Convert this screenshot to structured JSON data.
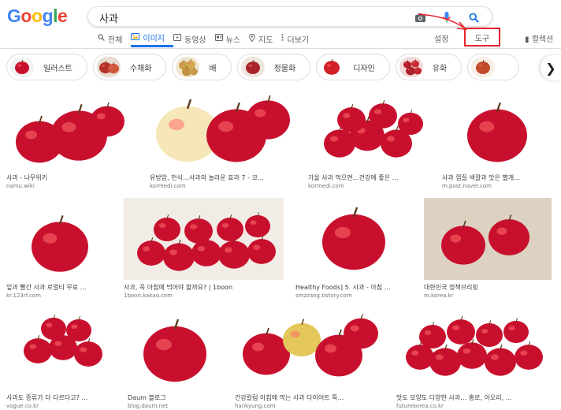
{
  "logo": {
    "letters": [
      "G",
      "o",
      "o",
      "g",
      "l",
      "e"
    ],
    "colors": [
      "#4285f4",
      "#ea4335",
      "#fbbc05",
      "#4285f4",
      "#34a853",
      "#ea4335"
    ]
  },
  "search": {
    "query": "사과"
  },
  "tabs": [
    {
      "label": "전체",
      "icon": "search-icon"
    },
    {
      "label": "이미지",
      "icon": "image-icon",
      "active": true
    },
    {
      "label": "동영상",
      "icon": "video-icon"
    },
    {
      "label": "뉴스",
      "icon": "news-icon"
    },
    {
      "label": "지도",
      "icon": "map-pin-icon"
    },
    {
      "label": "더보기",
      "icon": "more-icon"
    }
  ],
  "toolbar": {
    "settings": "설정",
    "tools": "도구",
    "collections": "컬렉션"
  },
  "chips": [
    {
      "label": "일러스트",
      "thumb": "apple-icon"
    },
    {
      "label": "수채화",
      "thumb": "apple-icon"
    },
    {
      "label": "배",
      "thumb": "pear-icon"
    },
    {
      "label": "정물화",
      "thumb": "apple-icon"
    },
    {
      "label": "디자인",
      "thumb": "apple-icon"
    },
    {
      "label": "유화",
      "thumb": "apple-icon"
    },
    {
      "label": "",
      "thumb": "apple-icon"
    }
  ],
  "accent": "#1a73e8",
  "highlight_color": "#e8242c",
  "results": [
    {
      "title": "사과 - 나무위키",
      "source": "namu.wiki"
    },
    {
      "title": "유방암, 천식…사과의 놀라운 효과 7 - 코…",
      "source": "kormedi.com"
    },
    {
      "title": "가을 사과 먹으면…건강에 좋은 …",
      "source": "kormedi.com"
    },
    {
      "title": "사과 껍질 색깔과 맛은 별개…",
      "source": "m.post.naver.com"
    },
    {
      "title": "잎과 빨간 사과 로열티 무료 …",
      "source": "kr.123rf.com"
    },
    {
      "title": "사과, 꼭 아침에 먹어야 할까요? | 1boon",
      "source": "1boon.kakao.com"
    },
    {
      "title": "Healthy Foods] 5. 사과 - 아침 …",
      "source": "smzzang.tistory.com"
    },
    {
      "title": "대한민국 정책브리핑",
      "source": "m.korea.kr"
    },
    {
      "title": "사과도 종류가 다 다르다고? …",
      "source": "vogue.co.kr"
    },
    {
      "title": "Daum 블로그",
      "source": "blog.daum.net"
    },
    {
      "title": "건강칼럼 아침에 먹는 사과 다이어트 특…",
      "source": "hankyung.com"
    },
    {
      "title": "맛도 모양도 다양한 사과… 홍로, 아오리, …",
      "source": "futurekorea.co.kr"
    }
  ]
}
